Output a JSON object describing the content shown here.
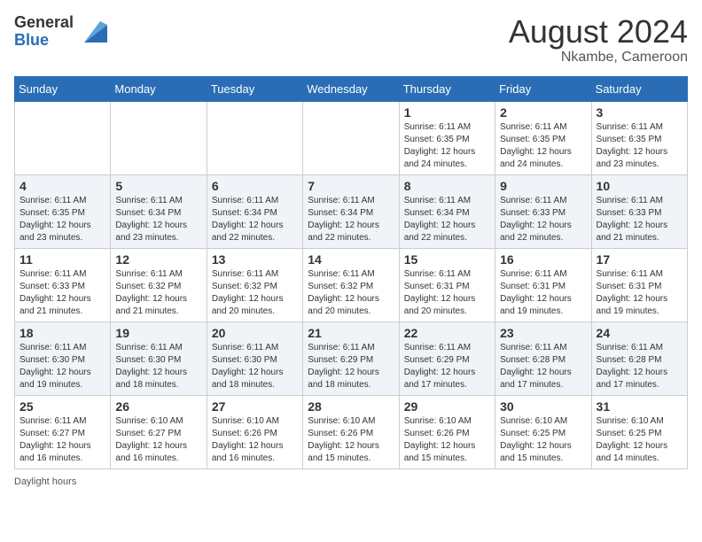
{
  "logo": {
    "general": "General",
    "blue": "Blue"
  },
  "header": {
    "month_year": "August 2024",
    "location": "Nkambe, Cameroon"
  },
  "days_of_week": [
    "Sunday",
    "Monday",
    "Tuesday",
    "Wednesday",
    "Thursday",
    "Friday",
    "Saturday"
  ],
  "weeks": [
    [
      {
        "day": "",
        "info": ""
      },
      {
        "day": "",
        "info": ""
      },
      {
        "day": "",
        "info": ""
      },
      {
        "day": "",
        "info": ""
      },
      {
        "day": "1",
        "info": "Sunrise: 6:11 AM\nSunset: 6:35 PM\nDaylight: 12 hours and 24 minutes."
      },
      {
        "day": "2",
        "info": "Sunrise: 6:11 AM\nSunset: 6:35 PM\nDaylight: 12 hours and 24 minutes."
      },
      {
        "day": "3",
        "info": "Sunrise: 6:11 AM\nSunset: 6:35 PM\nDaylight: 12 hours and 23 minutes."
      }
    ],
    [
      {
        "day": "4",
        "info": "Sunrise: 6:11 AM\nSunset: 6:35 PM\nDaylight: 12 hours and 23 minutes."
      },
      {
        "day": "5",
        "info": "Sunrise: 6:11 AM\nSunset: 6:34 PM\nDaylight: 12 hours and 23 minutes."
      },
      {
        "day": "6",
        "info": "Sunrise: 6:11 AM\nSunset: 6:34 PM\nDaylight: 12 hours and 22 minutes."
      },
      {
        "day": "7",
        "info": "Sunrise: 6:11 AM\nSunset: 6:34 PM\nDaylight: 12 hours and 22 minutes."
      },
      {
        "day": "8",
        "info": "Sunrise: 6:11 AM\nSunset: 6:34 PM\nDaylight: 12 hours and 22 minutes."
      },
      {
        "day": "9",
        "info": "Sunrise: 6:11 AM\nSunset: 6:33 PM\nDaylight: 12 hours and 22 minutes."
      },
      {
        "day": "10",
        "info": "Sunrise: 6:11 AM\nSunset: 6:33 PM\nDaylight: 12 hours and 21 minutes."
      }
    ],
    [
      {
        "day": "11",
        "info": "Sunrise: 6:11 AM\nSunset: 6:33 PM\nDaylight: 12 hours and 21 minutes."
      },
      {
        "day": "12",
        "info": "Sunrise: 6:11 AM\nSunset: 6:32 PM\nDaylight: 12 hours and 21 minutes."
      },
      {
        "day": "13",
        "info": "Sunrise: 6:11 AM\nSunset: 6:32 PM\nDaylight: 12 hours and 20 minutes."
      },
      {
        "day": "14",
        "info": "Sunrise: 6:11 AM\nSunset: 6:32 PM\nDaylight: 12 hours and 20 minutes."
      },
      {
        "day": "15",
        "info": "Sunrise: 6:11 AM\nSunset: 6:31 PM\nDaylight: 12 hours and 20 minutes."
      },
      {
        "day": "16",
        "info": "Sunrise: 6:11 AM\nSunset: 6:31 PM\nDaylight: 12 hours and 19 minutes."
      },
      {
        "day": "17",
        "info": "Sunrise: 6:11 AM\nSunset: 6:31 PM\nDaylight: 12 hours and 19 minutes."
      }
    ],
    [
      {
        "day": "18",
        "info": "Sunrise: 6:11 AM\nSunset: 6:30 PM\nDaylight: 12 hours and 19 minutes."
      },
      {
        "day": "19",
        "info": "Sunrise: 6:11 AM\nSunset: 6:30 PM\nDaylight: 12 hours and 18 minutes."
      },
      {
        "day": "20",
        "info": "Sunrise: 6:11 AM\nSunset: 6:30 PM\nDaylight: 12 hours and 18 minutes."
      },
      {
        "day": "21",
        "info": "Sunrise: 6:11 AM\nSunset: 6:29 PM\nDaylight: 12 hours and 18 minutes."
      },
      {
        "day": "22",
        "info": "Sunrise: 6:11 AM\nSunset: 6:29 PM\nDaylight: 12 hours and 17 minutes."
      },
      {
        "day": "23",
        "info": "Sunrise: 6:11 AM\nSunset: 6:28 PM\nDaylight: 12 hours and 17 minutes."
      },
      {
        "day": "24",
        "info": "Sunrise: 6:11 AM\nSunset: 6:28 PM\nDaylight: 12 hours and 17 minutes."
      }
    ],
    [
      {
        "day": "25",
        "info": "Sunrise: 6:11 AM\nSunset: 6:27 PM\nDaylight: 12 hours and 16 minutes."
      },
      {
        "day": "26",
        "info": "Sunrise: 6:10 AM\nSunset: 6:27 PM\nDaylight: 12 hours and 16 minutes."
      },
      {
        "day": "27",
        "info": "Sunrise: 6:10 AM\nSunset: 6:26 PM\nDaylight: 12 hours and 16 minutes."
      },
      {
        "day": "28",
        "info": "Sunrise: 6:10 AM\nSunset: 6:26 PM\nDaylight: 12 hours and 15 minutes."
      },
      {
        "day": "29",
        "info": "Sunrise: 6:10 AM\nSunset: 6:26 PM\nDaylight: 12 hours and 15 minutes."
      },
      {
        "day": "30",
        "info": "Sunrise: 6:10 AM\nSunset: 6:25 PM\nDaylight: 12 hours and 15 minutes."
      },
      {
        "day": "31",
        "info": "Sunrise: 6:10 AM\nSunset: 6:25 PM\nDaylight: 12 hours and 14 minutes."
      }
    ]
  ],
  "footer": {
    "daylight_label": "Daylight hours"
  }
}
